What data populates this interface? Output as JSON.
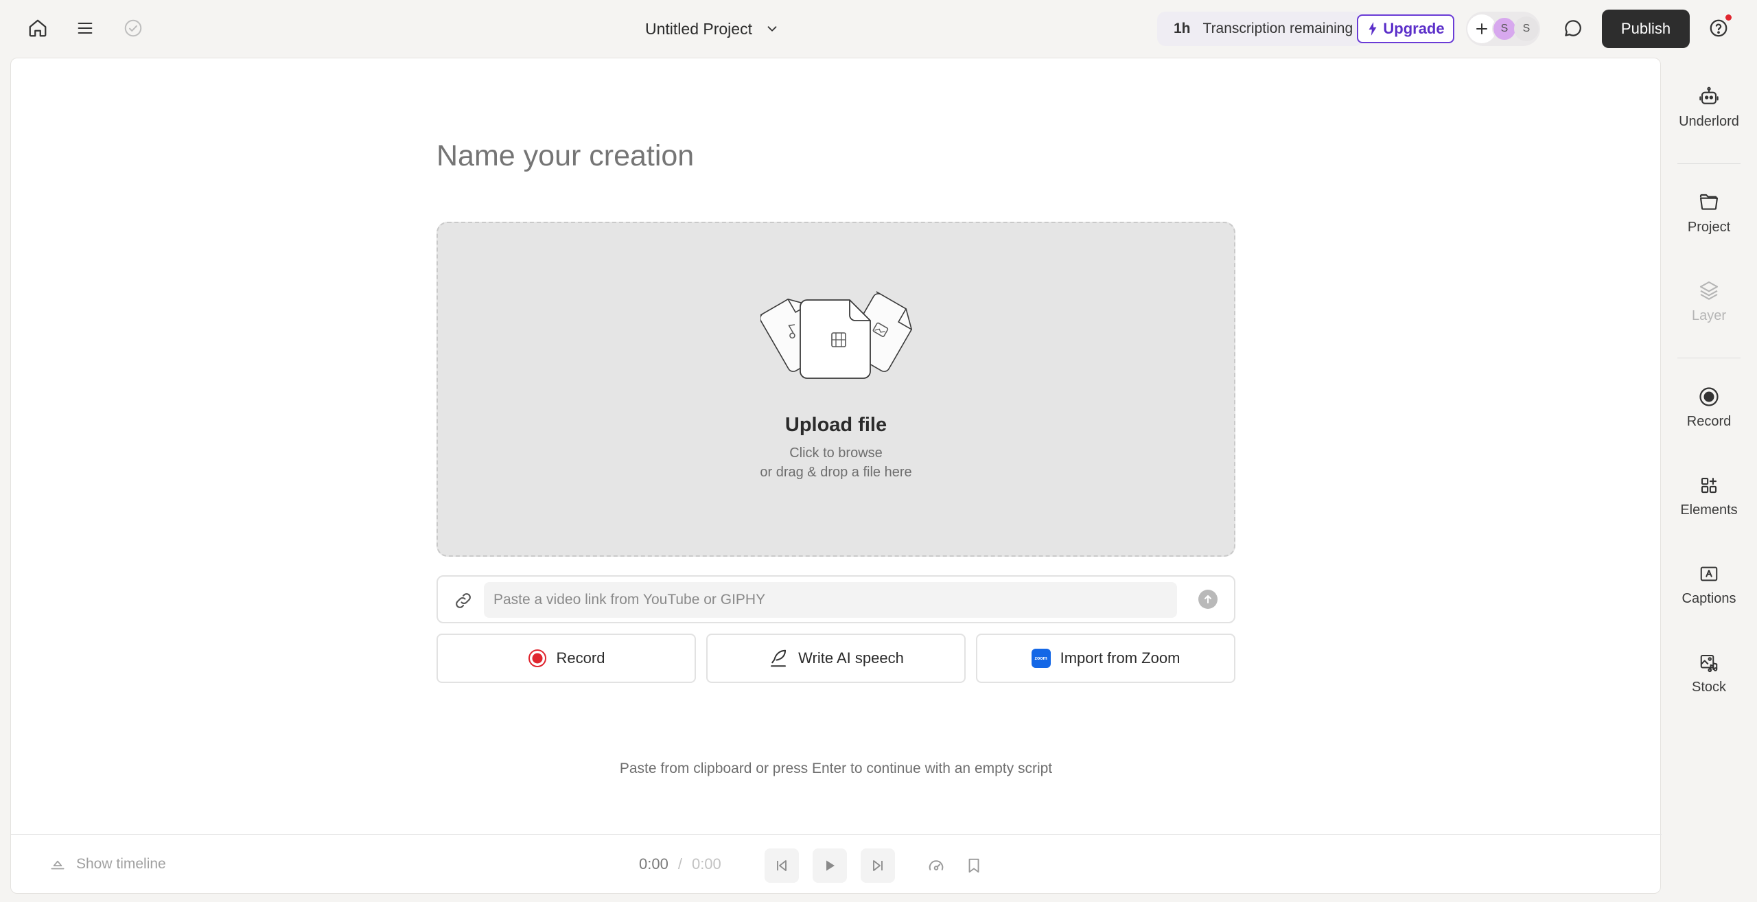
{
  "header": {
    "project_title": "Untitled Project",
    "transcription_amount": "1h",
    "transcription_label": "Transcription remaining",
    "upgrade_label": "Upgrade",
    "collaborators": [
      "S",
      "S"
    ],
    "publish_label": "Publish",
    "icons": [
      "home-icon",
      "menu-icon",
      "saved-check-icon",
      "chevron-down-icon",
      "plus-icon",
      "comment-icon",
      "help-icon"
    ]
  },
  "main": {
    "name_placeholder": "Name your creation",
    "upload": {
      "title": "Upload file",
      "line1": "Click to browse",
      "line2": "or drag & drop a file here"
    },
    "link_placeholder": "Paste a video link from YouTube or GIPHY",
    "actions": {
      "record_label": "Record",
      "write_ai_label": "Write AI speech",
      "zoom_label": "Import from Zoom",
      "zoom_logo_text": "zoom"
    },
    "hint": "Paste from clipboard or press Enter to continue with an empty script"
  },
  "transport": {
    "show_timeline_label": "Show timeline",
    "current_time": "0:00",
    "separator": "/",
    "duration": "0:00"
  },
  "sidebar": {
    "items": [
      {
        "label": "Underlord",
        "icon": "robot-icon"
      },
      {
        "label": "Project",
        "icon": "folder-icon"
      },
      {
        "label": "Layer",
        "icon": "layers-icon",
        "disabled": true
      },
      {
        "label": "Record",
        "icon": "record-icon"
      },
      {
        "label": "Elements",
        "icon": "elements-icon"
      },
      {
        "label": "Captions",
        "icon": "captions-icon"
      },
      {
        "label": "Stock",
        "icon": "stock-icon"
      }
    ]
  },
  "colors": {
    "accent": "#5b2fc9",
    "publish": "#2d2d2d",
    "record_red": "#e0262f",
    "zoom_blue": "#1467e6",
    "avatar_purple": "#d7a8ee"
  }
}
